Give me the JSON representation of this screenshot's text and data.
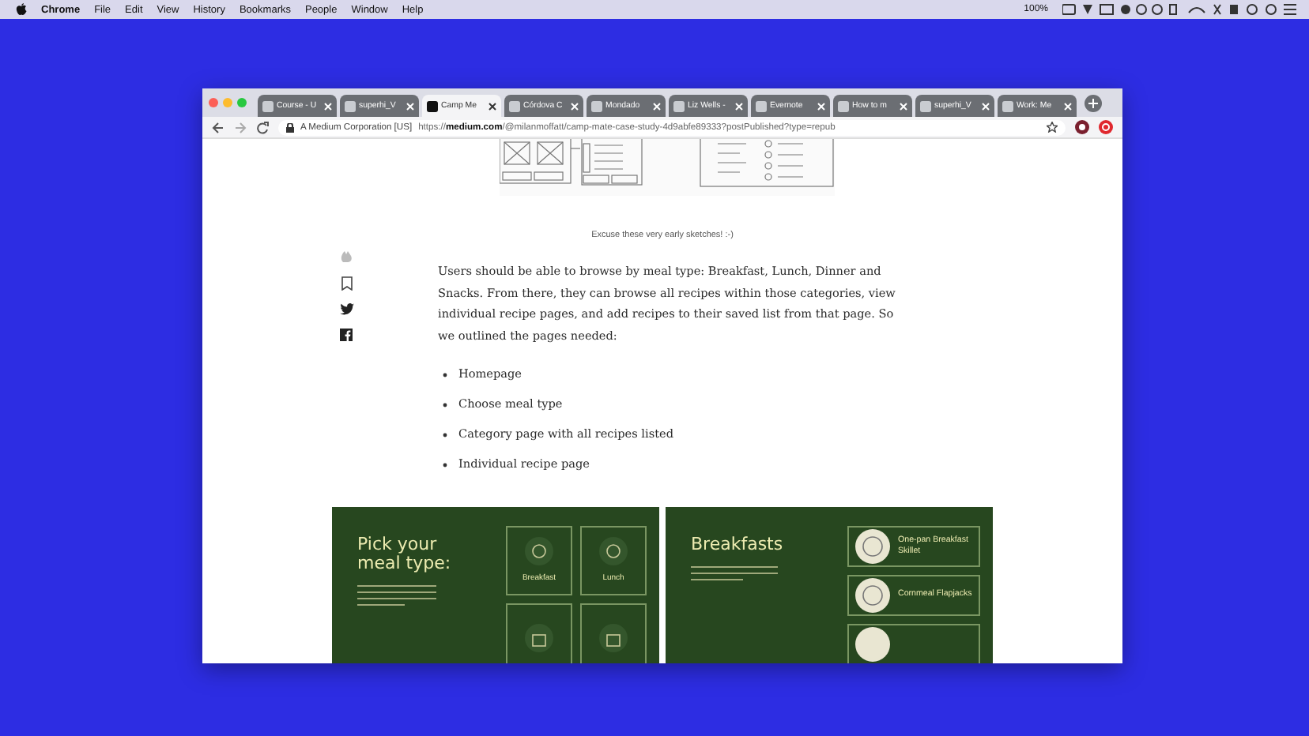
{
  "menu_bar": {
    "app": "Chrome",
    "items": [
      "File",
      "Edit",
      "View",
      "History",
      "Bookmarks",
      "People",
      "Window",
      "Help"
    ],
    "battery": "100%"
  },
  "browser": {
    "tabs": [
      {
        "title": "Course - U",
        "selected": false
      },
      {
        "title": "superhi_V",
        "selected": false
      },
      {
        "title": "Camp Me",
        "selected": true
      },
      {
        "title": "Córdova C",
        "selected": false
      },
      {
        "title": "Mondado",
        "selected": false
      },
      {
        "title": "Liz Wells -",
        "selected": false
      },
      {
        "title": "Evernote",
        "selected": false
      },
      {
        "title": "How to m",
        "selected": false
      },
      {
        "title": "superhi_V",
        "selected": false
      },
      {
        "title": "Work: Me",
        "selected": false
      }
    ],
    "address_bar": {
      "site_identity": "A Medium Corporation [US]",
      "url": "https://**medium.com**/@milanmoffatt/camp-mate-case-study-4d9abfe89333?postPublished?type=repub"
    }
  },
  "article": {
    "caption": "Excuse these very early sketches! :-)",
    "paragraph": "Users should be able to browse by meal type: Breakfast, Lunch, Dinner and Snacks. From there, they can browse all recipes within those categories, view individual recipe pages, and add recipes to their saved list from that page. So we outlined the pages needed:",
    "bullets": [
      "Homepage",
      "Choose meal type",
      "Category page with all recipes listed",
      "Individual recipe page"
    ],
    "mockups": [
      {
        "kind": "meal-types",
        "title": "Pick your meal type:",
        "tiles": [
          "Breakfast",
          "Lunch"
        ]
      },
      {
        "kind": "recipe-list",
        "title": "Breakfasts",
        "recipes": [
          "One-pan Breakfast Skillet",
          "Cornmeal Flapjacks"
        ]
      }
    ]
  }
}
